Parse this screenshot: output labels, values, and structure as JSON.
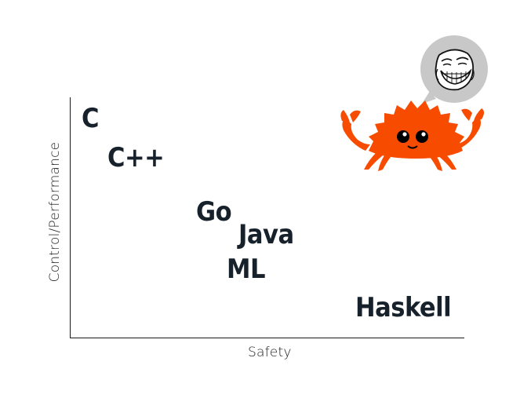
{
  "axes": {
    "xlabel": "Safety",
    "ylabel": "Control/Performance"
  },
  "languages": [
    {
      "id": "c",
      "label": "C"
    },
    {
      "id": "cpp",
      "label": "C++"
    },
    {
      "id": "go",
      "label": "Go"
    },
    {
      "id": "java",
      "label": "Java"
    },
    {
      "id": "ml",
      "label": "ML"
    },
    {
      "id": "haskell",
      "label": "Haskell"
    }
  ],
  "mascot": {
    "character": "ferris-crab-icon",
    "speech_bubble": "trollface-icon",
    "colors": {
      "body": "#f74c00",
      "bubble": "#c8c8c8",
      "eye": "#000000"
    }
  }
}
